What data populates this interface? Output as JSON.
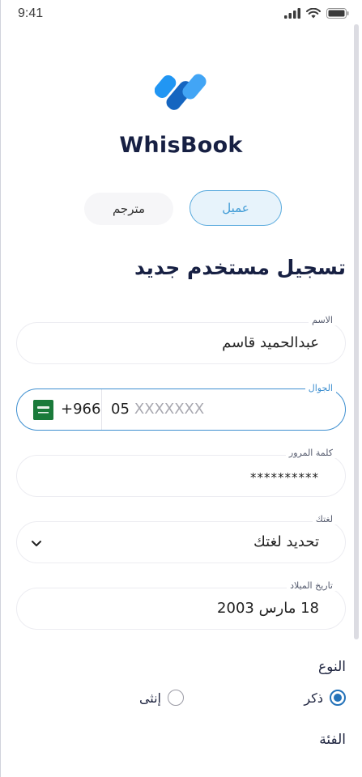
{
  "status_bar": {
    "time": "9:41",
    "icons": [
      "signal-icon",
      "wifi-icon",
      "battery-icon"
    ]
  },
  "brand": {
    "name": "WhisBook",
    "logo_colors": [
      "#1e88e5",
      "#42a5f5",
      "#1565c0"
    ]
  },
  "account_type": {
    "options": [
      {
        "label": "مترجم",
        "selected": false
      },
      {
        "label": "عميل",
        "selected": true
      }
    ]
  },
  "title": "تسجيل مستخدم جديد",
  "form": {
    "name": {
      "label": "الاسم",
      "value": "عبدالحميد قاسم"
    },
    "phone": {
      "label": "الجوال",
      "country_code": "+966",
      "prefix": "05",
      "placeholder": "XXXXXXX",
      "flag_icon": "saudi-flag-icon"
    },
    "password": {
      "label": "كلمة المرور",
      "value": "**********"
    },
    "language": {
      "label": "لغتك",
      "value": "تحديد لغتك"
    },
    "birthdate": {
      "label": "تاريخ الميلاد",
      "value": "18 مارس 2003"
    },
    "gender": {
      "label": "النوع",
      "options": [
        {
          "label": "ذكر",
          "selected": true
        },
        {
          "label": "إنثى",
          "selected": false
        }
      ]
    },
    "category": {
      "label": "الفئة"
    }
  },
  "colors": {
    "accent": "#3e8fd0",
    "dark_text": "#172043",
    "radio_selected": "#2472b9"
  }
}
